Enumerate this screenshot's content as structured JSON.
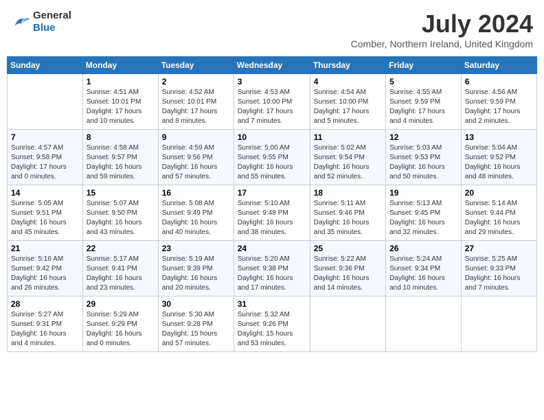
{
  "header": {
    "logo_general": "General",
    "logo_blue": "Blue",
    "month_year": "July 2024",
    "location": "Comber, Northern Ireland, United Kingdom"
  },
  "columns": [
    "Sunday",
    "Monday",
    "Tuesday",
    "Wednesday",
    "Thursday",
    "Friday",
    "Saturday"
  ],
  "weeks": [
    [
      {
        "day": "",
        "sunrise": "",
        "sunset": "",
        "daylight": ""
      },
      {
        "day": "1",
        "sunrise": "Sunrise: 4:51 AM",
        "sunset": "Sunset: 10:01 PM",
        "daylight": "Daylight: 17 hours and 10 minutes."
      },
      {
        "day": "2",
        "sunrise": "Sunrise: 4:52 AM",
        "sunset": "Sunset: 10:01 PM",
        "daylight": "Daylight: 17 hours and 8 minutes."
      },
      {
        "day": "3",
        "sunrise": "Sunrise: 4:53 AM",
        "sunset": "Sunset: 10:00 PM",
        "daylight": "Daylight: 17 hours and 7 minutes."
      },
      {
        "day": "4",
        "sunrise": "Sunrise: 4:54 AM",
        "sunset": "Sunset: 10:00 PM",
        "daylight": "Daylight: 17 hours and 5 minutes."
      },
      {
        "day": "5",
        "sunrise": "Sunrise: 4:55 AM",
        "sunset": "Sunset: 9:59 PM",
        "daylight": "Daylight: 17 hours and 4 minutes."
      },
      {
        "day": "6",
        "sunrise": "Sunrise: 4:56 AM",
        "sunset": "Sunset: 9:59 PM",
        "daylight": "Daylight: 17 hours and 2 minutes."
      }
    ],
    [
      {
        "day": "7",
        "sunrise": "Sunrise: 4:57 AM",
        "sunset": "Sunset: 9:58 PM",
        "daylight": "Daylight: 17 hours and 0 minutes."
      },
      {
        "day": "8",
        "sunrise": "Sunrise: 4:58 AM",
        "sunset": "Sunset: 9:57 PM",
        "daylight": "Daylight: 16 hours and 59 minutes."
      },
      {
        "day": "9",
        "sunrise": "Sunrise: 4:59 AM",
        "sunset": "Sunset: 9:56 PM",
        "daylight": "Daylight: 16 hours and 57 minutes."
      },
      {
        "day": "10",
        "sunrise": "Sunrise: 5:00 AM",
        "sunset": "Sunset: 9:55 PM",
        "daylight": "Daylight: 16 hours and 55 minutes."
      },
      {
        "day": "11",
        "sunrise": "Sunrise: 5:02 AM",
        "sunset": "Sunset: 9:54 PM",
        "daylight": "Daylight: 16 hours and 52 minutes."
      },
      {
        "day": "12",
        "sunrise": "Sunrise: 5:03 AM",
        "sunset": "Sunset: 9:53 PM",
        "daylight": "Daylight: 16 hours and 50 minutes."
      },
      {
        "day": "13",
        "sunrise": "Sunrise: 5:04 AM",
        "sunset": "Sunset: 9:52 PM",
        "daylight": "Daylight: 16 hours and 48 minutes."
      }
    ],
    [
      {
        "day": "14",
        "sunrise": "Sunrise: 5:05 AM",
        "sunset": "Sunset: 9:51 PM",
        "daylight": "Daylight: 16 hours and 45 minutes."
      },
      {
        "day": "15",
        "sunrise": "Sunrise: 5:07 AM",
        "sunset": "Sunset: 9:50 PM",
        "daylight": "Daylight: 16 hours and 43 minutes."
      },
      {
        "day": "16",
        "sunrise": "Sunrise: 5:08 AM",
        "sunset": "Sunset: 9:49 PM",
        "daylight": "Daylight: 16 hours and 40 minutes."
      },
      {
        "day": "17",
        "sunrise": "Sunrise: 5:10 AM",
        "sunset": "Sunset: 9:48 PM",
        "daylight": "Daylight: 16 hours and 38 minutes."
      },
      {
        "day": "18",
        "sunrise": "Sunrise: 5:11 AM",
        "sunset": "Sunset: 9:46 PM",
        "daylight": "Daylight: 16 hours and 35 minutes."
      },
      {
        "day": "19",
        "sunrise": "Sunrise: 5:13 AM",
        "sunset": "Sunset: 9:45 PM",
        "daylight": "Daylight: 16 hours and 32 minutes."
      },
      {
        "day": "20",
        "sunrise": "Sunrise: 5:14 AM",
        "sunset": "Sunset: 9:44 PM",
        "daylight": "Daylight: 16 hours and 29 minutes."
      }
    ],
    [
      {
        "day": "21",
        "sunrise": "Sunrise: 5:16 AM",
        "sunset": "Sunset: 9:42 PM",
        "daylight": "Daylight: 16 hours and 26 minutes."
      },
      {
        "day": "22",
        "sunrise": "Sunrise: 5:17 AM",
        "sunset": "Sunset: 9:41 PM",
        "daylight": "Daylight: 16 hours and 23 minutes."
      },
      {
        "day": "23",
        "sunrise": "Sunrise: 5:19 AM",
        "sunset": "Sunset: 9:39 PM",
        "daylight": "Daylight: 16 hours and 20 minutes."
      },
      {
        "day": "24",
        "sunrise": "Sunrise: 5:20 AM",
        "sunset": "Sunset: 9:38 PM",
        "daylight": "Daylight: 16 hours and 17 minutes."
      },
      {
        "day": "25",
        "sunrise": "Sunrise: 5:22 AM",
        "sunset": "Sunset: 9:36 PM",
        "daylight": "Daylight: 16 hours and 14 minutes."
      },
      {
        "day": "26",
        "sunrise": "Sunrise: 5:24 AM",
        "sunset": "Sunset: 9:34 PM",
        "daylight": "Daylight: 16 hours and 10 minutes."
      },
      {
        "day": "27",
        "sunrise": "Sunrise: 5:25 AM",
        "sunset": "Sunset: 9:33 PM",
        "daylight": "Daylight: 16 hours and 7 minutes."
      }
    ],
    [
      {
        "day": "28",
        "sunrise": "Sunrise: 5:27 AM",
        "sunset": "Sunset: 9:31 PM",
        "daylight": "Daylight: 16 hours and 4 minutes."
      },
      {
        "day": "29",
        "sunrise": "Sunrise: 5:29 AM",
        "sunset": "Sunset: 9:29 PM",
        "daylight": "Daylight: 16 hours and 0 minutes."
      },
      {
        "day": "30",
        "sunrise": "Sunrise: 5:30 AM",
        "sunset": "Sunset: 9:28 PM",
        "daylight": "Daylight: 15 hours and 57 minutes."
      },
      {
        "day": "31",
        "sunrise": "Sunrise: 5:32 AM",
        "sunset": "Sunset: 9:26 PM",
        "daylight": "Daylight: 15 hours and 53 minutes."
      },
      {
        "day": "",
        "sunrise": "",
        "sunset": "",
        "daylight": ""
      },
      {
        "day": "",
        "sunrise": "",
        "sunset": "",
        "daylight": ""
      },
      {
        "day": "",
        "sunrise": "",
        "sunset": "",
        "daylight": ""
      }
    ]
  ]
}
